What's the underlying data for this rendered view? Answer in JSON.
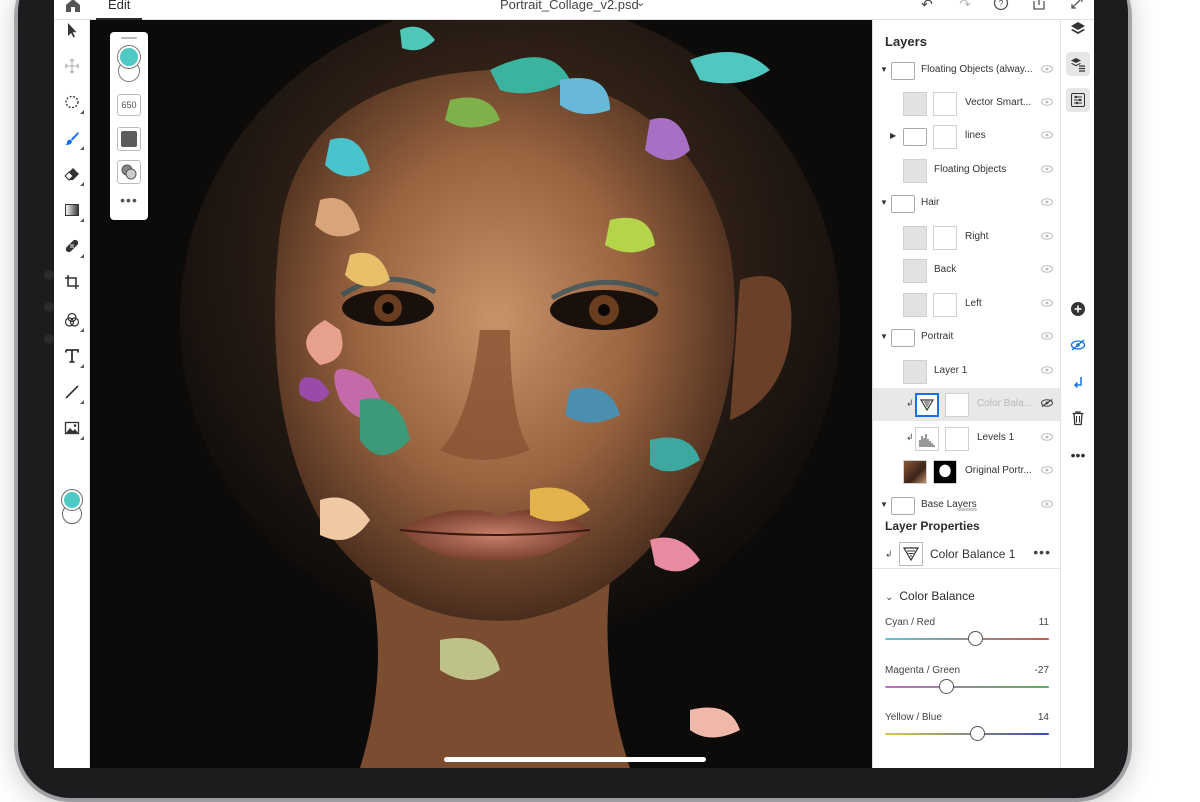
{
  "topbar": {
    "edit_tab": "Edit",
    "document_title": "Portrait_Collage_v2.psd"
  },
  "brush_panel": {
    "brush_size": "650",
    "foreground_color": "#4fc9c3"
  },
  "layers_panel": {
    "title": "Layers",
    "rows": [
      {
        "name": "Floating Objects (alway...",
        "kind": "group",
        "expanded": true
      },
      {
        "name": "Vector Smart...",
        "kind": "layer"
      },
      {
        "name": "lines",
        "kind": "group",
        "expanded": false
      },
      {
        "name": "Floating Objects",
        "kind": "layer"
      },
      {
        "name": "Hair",
        "kind": "group",
        "expanded": true
      },
      {
        "name": "Right",
        "kind": "layer"
      },
      {
        "name": "Back",
        "kind": "layer"
      },
      {
        "name": "Left",
        "kind": "layer"
      },
      {
        "name": "Portrait",
        "kind": "group",
        "expanded": true
      },
      {
        "name": "Layer 1",
        "kind": "layer"
      },
      {
        "name": "Color Bala...",
        "kind": "adjustment",
        "selected": true,
        "hidden": true
      },
      {
        "name": "Levels 1",
        "kind": "adjustment"
      },
      {
        "name": "Original Portr...",
        "kind": "layer"
      },
      {
        "name": "Base Layers",
        "kind": "group",
        "expanded": true
      }
    ]
  },
  "layer_properties": {
    "title": "Layer Properties",
    "layer_name": "Color Balance 1"
  },
  "color_balance": {
    "title": "Color Balance",
    "sliders": [
      {
        "label": "Cyan / Red",
        "value": "11",
        "fraction": 0.55
      },
      {
        "label": "Magenta / Green",
        "value": "-27",
        "fraction": 0.37
      },
      {
        "label": "Yellow / Blue",
        "value": "14",
        "fraction": 0.56
      }
    ]
  },
  "colors": {
    "accent_selection": "#1473e6",
    "fg_color": "#4fc9c3"
  }
}
